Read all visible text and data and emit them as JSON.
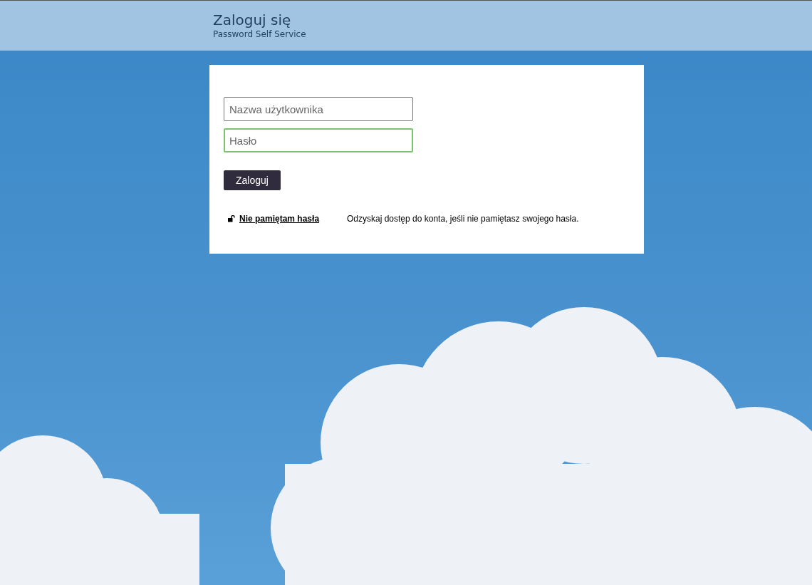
{
  "header": {
    "title": "Zaloguj się",
    "subtitle": "Password Self Service"
  },
  "login_form": {
    "fields": [
      {
        "placeholder": "Nazwa użytkownika",
        "focused": false
      },
      {
        "placeholder": "Hasło",
        "focused": true
      }
    ],
    "submit_button": "Zaloguj",
    "options": [
      {
        "link": "Nie pamiętam hasła",
        "description": "Odzyskaj dostęp do konta, jeśli nie pamiętasz swojego hasła."
      }
    ]
  }
}
